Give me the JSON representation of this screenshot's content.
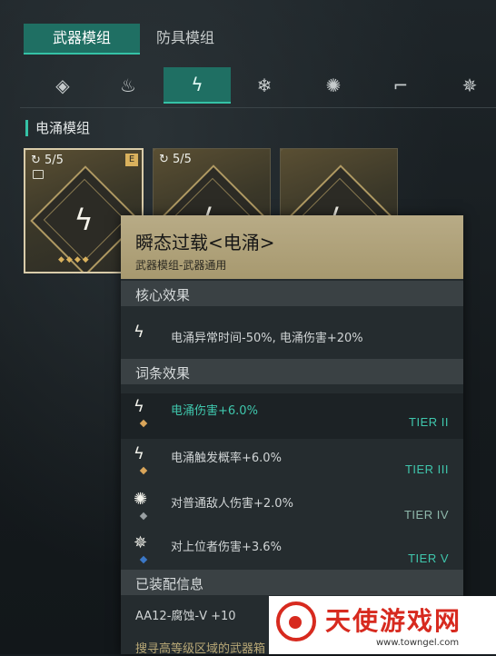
{
  "tabs": {
    "weapon": "武器模组",
    "armor": "防具模组"
  },
  "categories": [
    {
      "icon": "diamond-icon",
      "glyph": "◈"
    },
    {
      "icon": "fire-icon",
      "glyph": "♨"
    },
    {
      "icon": "lightning-icon",
      "glyph": "ϟ"
    },
    {
      "icon": "snowflake-icon",
      "glyph": "❄"
    },
    {
      "icon": "burst-icon",
      "glyph": "✺"
    },
    {
      "icon": "gun-icon",
      "glyph": "⌐"
    },
    {
      "icon": "spark-icon",
      "glyph": "✵"
    }
  ],
  "section_title": "电涌模组",
  "cards": [
    {
      "count": "5/5",
      "grade": "E",
      "glyph": "ϟ"
    },
    {
      "count": "5/5",
      "glyph": "ϟ"
    },
    {
      "count": "",
      "glyph": "ϟ"
    }
  ],
  "tooltip": {
    "title": "瞬态过载<电涌>",
    "subtitle": "武器模组-武器通用",
    "core_header": "核心效果",
    "core_text": "电涌异常时间-50%, 电涌伤害+20%",
    "affix_header": "词条效果",
    "affixes": [
      {
        "text": "电涌伤害+6.0%",
        "tier": "TIER II",
        "marker": "#d9a55a"
      },
      {
        "text": "电涌触发概率+6.0%",
        "tier": "TIER III",
        "marker": "#d9a55a"
      },
      {
        "text": "对普通敌人伤害+2.0%",
        "tier": "TIER IV",
        "marker": "#9aa0a3"
      },
      {
        "text": "对上位者伤害+3.6%",
        "tier": "TIER V",
        "marker": "#3b78c7"
      }
    ],
    "equip_header": "已装配信息",
    "equip_text": "AA12-腐蚀-V +10",
    "hint_text": "搜寻高等级区域的武器箱"
  },
  "watermark": {
    "title": "天使游戏网",
    "url": "www.towngel.com"
  },
  "colors": {
    "accent": "#35c2a6",
    "tab_active": "#1f6f63",
    "header_gold": "#b8ab86"
  }
}
